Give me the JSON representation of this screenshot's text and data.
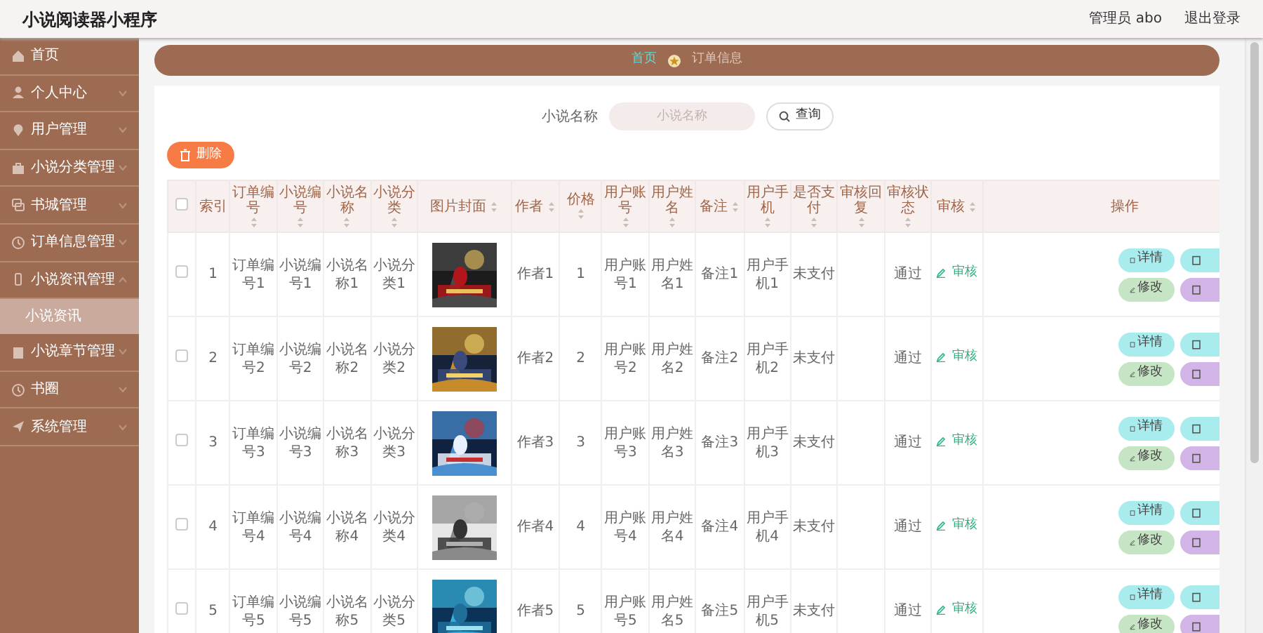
{
  "app": {
    "title": "小说阅读器小程序",
    "user": "管理员 abo",
    "logout": "退出登录"
  },
  "sidebar": {
    "items": [
      {
        "label": "首页",
        "selected": false
      },
      {
        "label": "个人中心",
        "expanded": false,
        "selected": false
      },
      {
        "label": "用户管理",
        "expanded": false,
        "selected": false
      },
      {
        "label": "小说分类管理",
        "expanded": false,
        "selected": false
      },
      {
        "label": "书城管理",
        "expanded": false,
        "selected": false
      },
      {
        "label": "订单信息管理",
        "expanded": false,
        "selected": false
      },
      {
        "label": "小说资讯管理",
        "expanded": true,
        "selected": false,
        "children": [
          {
            "label": "小说资讯",
            "selected": true
          }
        ]
      },
      {
        "label": "小说章节管理",
        "expanded": false,
        "selected": false
      },
      {
        "label": "书圈",
        "expanded": false,
        "selected": false
      },
      {
        "label": "系统管理",
        "expanded": false,
        "selected": false
      }
    ]
  },
  "breadcrumb": [
    {
      "label": "首页"
    },
    {
      "label": "订单信息"
    }
  ],
  "search": {
    "label": "小说名称",
    "placeholder": "小说名称",
    "button": "查询"
  },
  "delete_button": "删除",
  "table": {
    "header_checked": false,
    "columns": [
      {
        "label": "索引",
        "sortable": false
      },
      {
        "label": "订单编号",
        "sortable": true
      },
      {
        "label": "小说编号",
        "sortable": true
      },
      {
        "label": "小说名称",
        "sortable": true
      },
      {
        "label": "小说分类",
        "sortable": true
      },
      {
        "label": "图片封面",
        "sortable": true
      },
      {
        "label": "作者",
        "sortable": true
      },
      {
        "label": "价格",
        "sortable": true
      },
      {
        "label": "用户账号",
        "sortable": true
      },
      {
        "label": "用户姓名",
        "sortable": true
      },
      {
        "label": "备注",
        "sortable": true
      },
      {
        "label": "用户手机",
        "sortable": true
      },
      {
        "label": "是否支付",
        "sortable": true
      },
      {
        "label": "审核回复",
        "sortable": true
      },
      {
        "label": "审核状态",
        "sortable": true
      },
      {
        "label": "审核",
        "sortable": true
      },
      {
        "label": "操作",
        "sortable": false
      }
    ],
    "rows": [
      {
        "checked": false,
        "cells": [
          "1",
          "订单编号1",
          "小说编号1",
          "小说名称1",
          "小说分类1",
          {
            "kind": "picture"
          },
          "作者1",
          "1",
          "用户账号1",
          "用户姓名1",
          "备注1",
          "用户手机1",
          "未支付",
          "",
          "通过",
          {
            "kind": "review",
            "label": "审核"
          },
          {
            "kind": "actions",
            "buttons": [
              {
                "kind": "detail",
                "label": "详情"
              },
              {
                "kind": "detail"
              },
              {
                "kind": "edit",
                "label": "修改"
              },
              {
                "kind": "delete"
              }
            ]
          }
        ]
      },
      {
        "checked": false,
        "cells": [
          "2",
          "订单编号2",
          "小说编号2",
          "小说名称2",
          "小说分类2",
          {
            "kind": "picture"
          },
          "作者2",
          "2",
          "用户账号2",
          "用户姓名2",
          "备注2",
          "用户手机2",
          "未支付",
          "",
          "通过",
          {
            "kind": "review",
            "label": "审核"
          },
          {
            "kind": "actions",
            "buttons": [
              {
                "kind": "detail",
                "label": "详情"
              },
              {
                "kind": "detail"
              },
              {
                "kind": "edit",
                "label": "修改"
              },
              {
                "kind": "delete"
              }
            ]
          }
        ]
      },
      {
        "checked": false,
        "cells": [
          "3",
          "订单编号3",
          "小说编号3",
          "小说名称3",
          "小说分类3",
          {
            "kind": "picture"
          },
          "作者3",
          "3",
          "用户账号3",
          "用户姓名3",
          "备注3",
          "用户手机3",
          "未支付",
          "",
          "通过",
          {
            "kind": "review",
            "label": "审核"
          },
          {
            "kind": "actions",
            "buttons": [
              {
                "kind": "detail",
                "label": "详情"
              },
              {
                "kind": "detail"
              },
              {
                "kind": "edit",
                "label": "修改"
              },
              {
                "kind": "delete"
              }
            ]
          }
        ]
      },
      {
        "checked": false,
        "cells": [
          "4",
          "订单编号4",
          "小说编号4",
          "小说名称4",
          "小说分类4",
          {
            "kind": "picture"
          },
          "作者4",
          "4",
          "用户账号4",
          "用户姓名4",
          "备注4",
          "用户手机4",
          "未支付",
          "",
          "通过",
          {
            "kind": "review",
            "label": "审核"
          },
          {
            "kind": "actions",
            "buttons": [
              {
                "kind": "detail",
                "label": "详情"
              },
              {
                "kind": "detail"
              },
              {
                "kind": "edit",
                "label": "修改"
              },
              {
                "kind": "delete"
              }
            ]
          }
        ]
      },
      {
        "checked": false,
        "cells": [
          "5",
          "订单编号5",
          "小说编号5",
          "小说名称5",
          "小说分类5",
          {
            "kind": "picture"
          },
          "作者5",
          "5",
          "用户账号5",
          "用户姓名5",
          "备注5",
          "用户手机5",
          "未支付",
          "",
          "通过",
          {
            "kind": "review",
            "label": "审核"
          },
          {
            "kind": "actions",
            "buttons": [
              {
                "kind": "detail",
                "label": "详情"
              },
              {
                "kind": "detail"
              },
              {
                "kind": "edit",
                "label": "修改"
              },
              {
                "kind": "delete"
              }
            ]
          }
        ]
      }
    ]
  }
}
